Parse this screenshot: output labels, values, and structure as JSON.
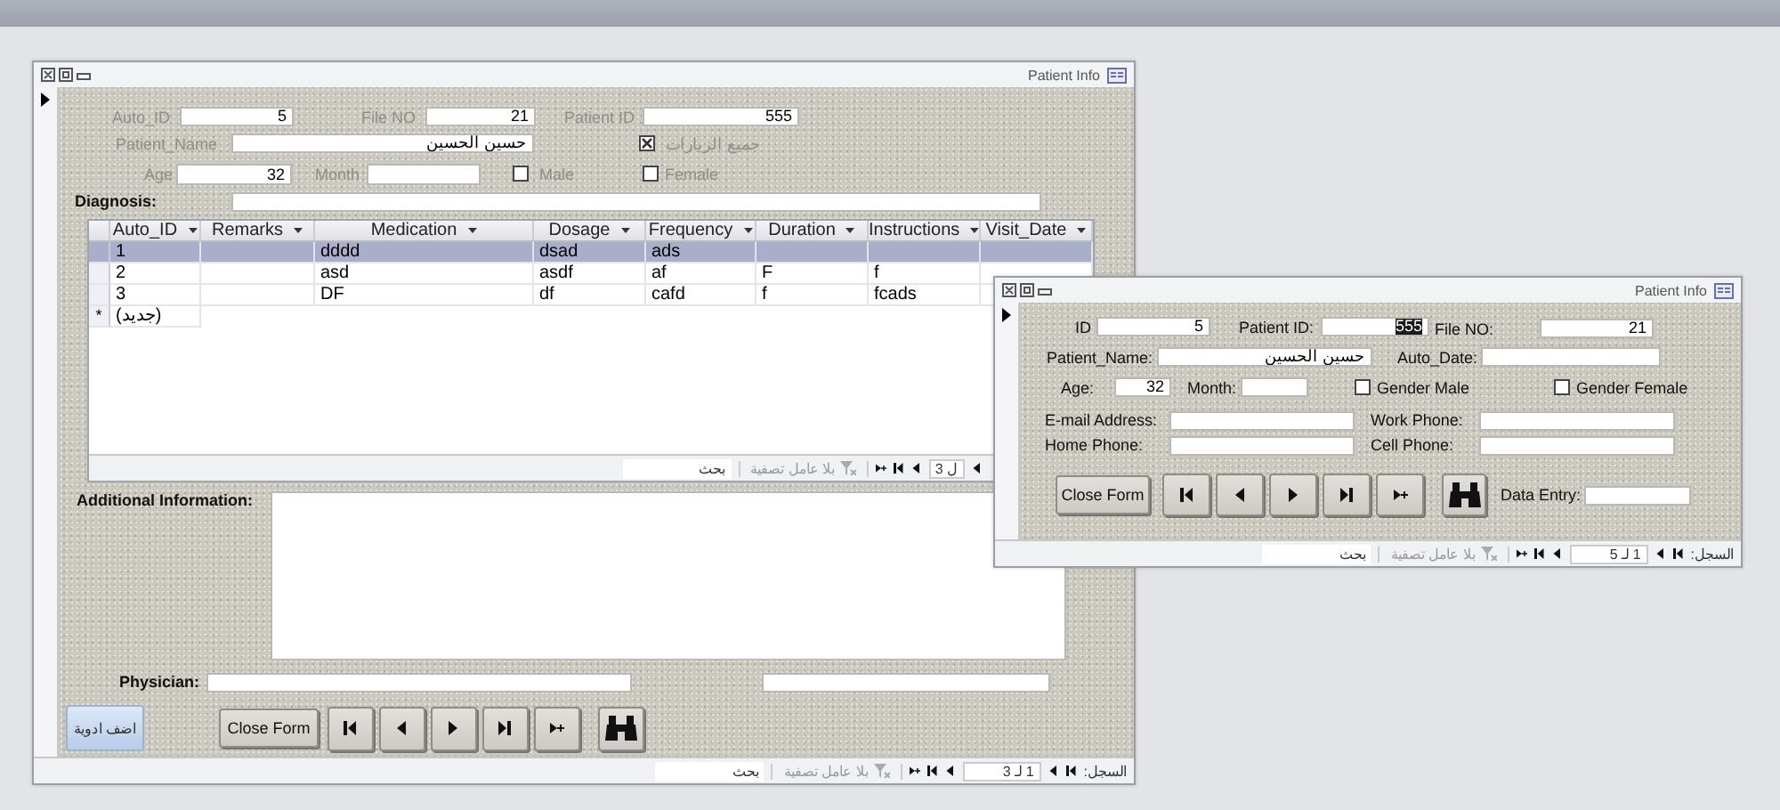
{
  "main_window": {
    "title": "Patient Info",
    "fields": {
      "auto_id": {
        "label": "Auto_ID",
        "value": "5"
      },
      "file_no": {
        "label": "File NO",
        "value": "21"
      },
      "patient_id": {
        "label": "Patient ID",
        "value": "555"
      },
      "patient_name": {
        "label": "Patient_Name",
        "value": "حسين الحسين"
      },
      "age": {
        "label": "Age",
        "value": "32"
      },
      "month": {
        "label": "Month"
      },
      "diagnosis": {
        "label": "Diagnosis:"
      },
      "additional_info": {
        "label": "Additional Information:"
      },
      "physician": {
        "label": "Physician:"
      }
    },
    "checkboxes": [
      {
        "label": "جميع الزيارات",
        "checked": true
      },
      {
        "label": "Male",
        "checked": false
      },
      {
        "label": "Female",
        "checked": false
      }
    ],
    "subform": {
      "columns": [
        "Auto_ID",
        "Remarks",
        "Medication",
        "Dosage",
        "Frequency",
        "Duration",
        "Instructions",
        "Visit_Date"
      ],
      "rows": [
        {
          "selected": true,
          "cells": [
            "1",
            null,
            "dddd",
            "dsad",
            "ads",
            null,
            null,
            null
          ]
        },
        {
          "selected": false,
          "cells": [
            "2",
            null,
            "asd",
            "asdf",
            "af",
            "F",
            "f",
            null
          ]
        },
        {
          "selected": false,
          "cells": [
            "3",
            null,
            "DF",
            "df",
            "cafd",
            "f",
            "fcads",
            null
          ]
        }
      ],
      "new_row": {
        "marker": "*",
        "label": "(جديد)"
      },
      "nav": {
        "position": "ل 3",
        "filter": "بلا عامل تصفية",
        "search": "بحث"
      }
    },
    "add_button": "اضف ادوية",
    "close_button": "Close Form",
    "nav_buttons": [
      {
        "kind": "first"
      },
      {
        "kind": "prev"
      },
      {
        "kind": "next"
      },
      {
        "kind": "last"
      },
      {
        "kind": "new"
      }
    ],
    "nav": {
      "record_label": "السجل:",
      "position": "1 لـ 3",
      "filter": "بلا عامل تصفية",
      "search": "بحث"
    }
  },
  "second_window": {
    "title": "Patient Info",
    "fields": {
      "id": {
        "label": "ID",
        "value": "5"
      },
      "patient_id": {
        "label": "Patient ID:",
        "value": "555",
        "selected": true
      },
      "file_no": {
        "label": "File NO:",
        "value": "21"
      },
      "patient_name": {
        "label": "Patient_Name:",
        "value": "حسين الحسين"
      },
      "auto_date": {
        "label": "Auto_Date:"
      },
      "age": {
        "label": "Age:",
        "value": "32"
      },
      "month": {
        "label": "Month:"
      },
      "email": {
        "label": "E-mail Address:"
      },
      "work_phone": {
        "label": "Work Phone:"
      },
      "home_phone": {
        "label": "Home Phone:"
      },
      "cell_phone": {
        "label": "Cell Phone:"
      },
      "data_entry": {
        "label": "Data Entry:"
      }
    },
    "checkboxes": [
      {
        "label": "Gender Male",
        "checked": false
      },
      {
        "label": "Gender Female",
        "checked": false
      }
    ],
    "close_button": "Close Form",
    "nav_buttons": [
      {
        "kind": "first"
      },
      {
        "kind": "prev"
      },
      {
        "kind": "next"
      },
      {
        "kind": "last"
      },
      {
        "kind": "new"
      }
    ],
    "nav": {
      "record_label": "السجل:",
      "position": "1 لـ 5",
      "filter": "بلا عامل تصفية",
      "search": "بحث"
    }
  }
}
